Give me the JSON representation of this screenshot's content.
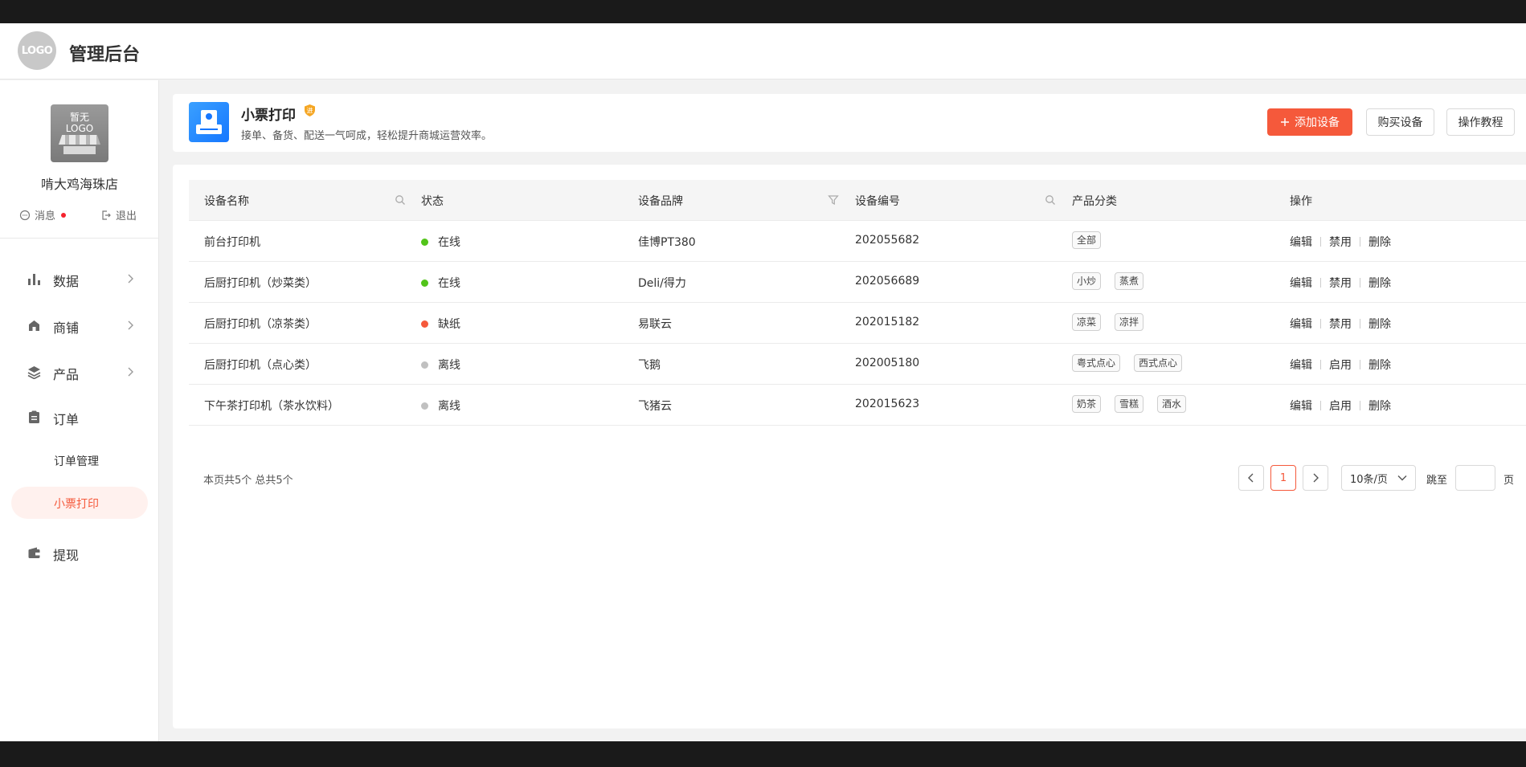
{
  "header": {
    "logo_text": "LOGO",
    "title": "管理后台"
  },
  "sidebar": {
    "store_logo_text": "暂无\nLOGO",
    "store_logo_line1": "暂无",
    "store_logo_line2": "LOGO",
    "store_name": "啃大鸡海珠店",
    "messages_label": "消息",
    "logout_label": "退出",
    "nav": [
      {
        "label": "数据",
        "icon": "bar-chart-icon",
        "has_arrow": true
      },
      {
        "label": "商铺",
        "icon": "shop-icon",
        "has_arrow": true
      },
      {
        "label": "产品",
        "icon": "layers-icon",
        "has_arrow": true
      },
      {
        "label": "订单",
        "icon": "clipboard-icon",
        "has_arrow": false
      },
      {
        "label": "提现",
        "icon": "wallet-icon",
        "has_arrow": false
      }
    ],
    "order_sub": [
      {
        "label": "订单管理",
        "active": false
      },
      {
        "label": "小票打印",
        "active": true
      }
    ]
  },
  "banner": {
    "title": "小票打印",
    "badge": "进",
    "description": "接单、备货、配送一气呵成，轻松提升商城运营效率。",
    "add_button": "添加设备",
    "buy_button": "购买设备",
    "guide_button": "操作教程"
  },
  "table": {
    "columns": [
      "设备名称",
      "状态",
      "设备品牌",
      "设备编号",
      "产品分类",
      "操作"
    ],
    "rows": [
      {
        "name": "前台打印机",
        "status": "在线",
        "status_color": "#52c41a",
        "brand": "佳博PT380",
        "code": "202055682",
        "tags": [
          "全部"
        ],
        "ops": [
          "编辑",
          "禁用",
          "删除"
        ]
      },
      {
        "name": "后厨打印机（炒菜类）",
        "status": "在线",
        "status_color": "#52c41a",
        "brand": "Deli/得力",
        "code": "202056689",
        "tags": [
          "小炒",
          "蒸煮"
        ],
        "ops": [
          "编辑",
          "禁用",
          "删除"
        ]
      },
      {
        "name": "后厨打印机（凉茶类）",
        "status": "缺纸",
        "status_color": "#f5593b",
        "brand": "易联云",
        "code": "202015182",
        "tags": [
          "凉菜",
          "凉拌"
        ],
        "ops": [
          "编辑",
          "禁用",
          "删除"
        ]
      },
      {
        "name": "后厨打印机（点心类）",
        "status": "离线",
        "status_color": "#c0c0c0",
        "brand": "飞鹅",
        "code": "202005180",
        "tags": [
          "粤式点心",
          "西式点心"
        ],
        "ops": [
          "编辑",
          "启用",
          "删除"
        ]
      },
      {
        "name": "下午茶打印机（茶水饮料）",
        "status": "离线",
        "status_color": "#c0c0c0",
        "brand": "飞猪云",
        "code": "202015623",
        "tags": [
          "奶茶",
          "雪糕",
          "酒水"
        ],
        "ops": [
          "编辑",
          "启用",
          "删除"
        ]
      }
    ]
  },
  "pagination": {
    "summary": "本页共5个  总共5个",
    "current_page": "1",
    "page_size": "10条/页",
    "jump_label": "跳至",
    "page_label": "页"
  },
  "colors": {
    "accent": "#f5593b",
    "online": "#52c41a",
    "offline": "#c0c0c0"
  }
}
